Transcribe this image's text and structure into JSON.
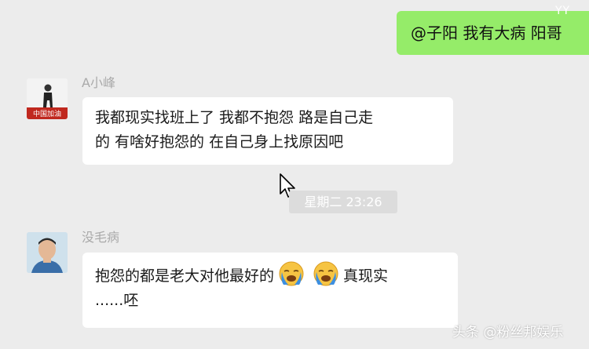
{
  "sent_message": {
    "text": "@子阳 我有大病  阳哥",
    "corner_mark": "YY"
  },
  "messages": [
    {
      "sender": "A小峰",
      "avatar_text": "中国加油",
      "lines": [
        "我都现实找班上了 我都不抱怨  路是自己走",
        "的 有啥好抱怨的 在自己身上找原因吧"
      ]
    },
    {
      "sender": "没毛病",
      "line1_before": "抱怨的都是老大对他最好的",
      "emoji": "crying-face-icon",
      "line1_after": "真现实",
      "line2": "......呸"
    }
  ],
  "timestamp": "星期二 23:26",
  "watermark": "头条 @粉丝邦娱乐",
  "colors": {
    "background": "#ececec",
    "sent_bubble": "#95ec69",
    "received_bubble": "#ffffff"
  }
}
